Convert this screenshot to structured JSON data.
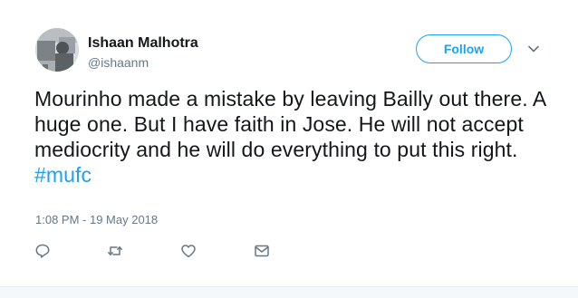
{
  "user": {
    "display_name": "Ishaan Malhotra",
    "handle": "@ishaanm",
    "avatar_icon": "profile-photo"
  },
  "header": {
    "follow_label": "Follow",
    "menu_icon": "chevron-down-icon"
  },
  "tweet": {
    "text_plain": "Mourinho made a mistake by leaving Bailly out there. A huge one. But I have faith in Jose. He will not accept mediocrity and he will do everything to put this right.",
    "hashtag": "#mufc",
    "timestamp": "1:08 PM - 19 May 2018"
  },
  "actions": [
    {
      "name": "reply",
      "icon": "reply-icon"
    },
    {
      "name": "retweet",
      "icon": "retweet-icon"
    },
    {
      "name": "like",
      "icon": "heart-icon"
    },
    {
      "name": "direct-message",
      "icon": "envelope-icon"
    }
  ],
  "colors": {
    "accent": "#1da1f2",
    "text": "#14171a",
    "secondary": "#657786",
    "background": "#ffffff",
    "footer": "#f5f8fa"
  }
}
